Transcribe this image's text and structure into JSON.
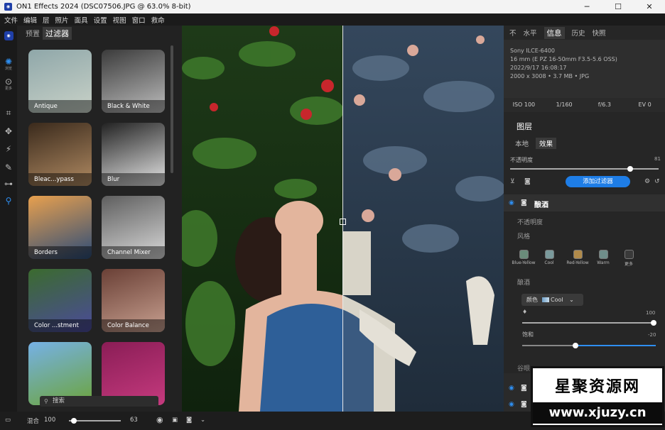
{
  "window": {
    "title": "ON1 Effects 2024 (DSC07506.JPG @ 63.0% 8-bit)"
  },
  "menu": [
    "文件",
    "编辑",
    "层",
    "照片",
    "面具",
    "设置",
    "视图",
    "窗口",
    "救命"
  ],
  "toolbar": {
    "browse_label": "浏览",
    "more_label": "更多"
  },
  "browser": {
    "tabs": [
      "预置",
      "过滤器"
    ],
    "search_placeholder": "搜索",
    "filters": [
      {
        "label": "Antique",
        "colors": [
          "#8fa7a9",
          "#c9d2c8"
        ]
      },
      {
        "label": "Black & White",
        "colors": [
          "#3b3b3b",
          "#bdbdbd"
        ]
      },
      {
        "label": "Bleac...ypass",
        "colors": [
          "#3a2a1c",
          "#b08a62"
        ]
      },
      {
        "label": "Blur",
        "colors": [
          "#222222",
          "#e6e6e6"
        ]
      },
      {
        "label": "Borders",
        "colors": [
          "#e8a04e",
          "#2c4c78"
        ]
      },
      {
        "label": "Channel Mixer",
        "colors": [
          "#5e5e5e",
          "#d8d8d8"
        ]
      },
      {
        "label": "Color ...stment",
        "colors": [
          "#3b6b2e",
          "#4b4a9a"
        ]
      },
      {
        "label": "Color Balance",
        "colors": [
          "#6a4036",
          "#c8a090"
        ]
      },
      {
        "label": "",
        "colors": [
          "#76b1e6",
          "#6ca43c"
        ]
      },
      {
        "label": "",
        "colors": [
          "#8a1d56",
          "#c53a7e"
        ]
      }
    ]
  },
  "info_panel": {
    "tabs": [
      "不",
      "水平",
      "信息",
      "历史",
      "快照"
    ],
    "camera": "Sony ILCE-6400",
    "lens": "16 mm (E PZ 16-50mm F3.5-5.6 OSS)",
    "datetime": "2022/9/17  16:08:17",
    "dimensions": "2000 x 3008 • 3.7 MB • JPG",
    "iso": "ISO 100",
    "shutter": "1/160",
    "aperture": "f/6.3",
    "ev": "EV 0"
  },
  "layers": {
    "title": "图层",
    "tabs": [
      "本地",
      "效果"
    ],
    "opacity_label": "不透明度",
    "opacity_value": "81",
    "opacity_fraction": 0.81,
    "add_filter": "添加过滤器"
  },
  "effect": {
    "name": "酿酒",
    "opacity_label": "不透明度",
    "style_label": "风格",
    "styles": [
      {
        "name": "Blue-Yellow",
        "color": "#6a8c7a"
      },
      {
        "name": "Cool",
        "color": "#7a9a9c"
      },
      {
        "name": "Red-Yellow",
        "color": "#b08a4a"
      },
      {
        "name": "Warm",
        "color": "#6f8e8a"
      },
      {
        "name": "更多",
        "color": "#3a3a3a"
      }
    ],
    "section_label": "酿酒",
    "color_label": "颜色",
    "color_value": "Cool",
    "amount_value": "100",
    "amount_fraction": 1.0,
    "saturation_label": "饱和",
    "saturation_value": "-20",
    "saturation_fraction": 0.4,
    "next_section": "谷眼"
  },
  "statusbar": {
    "mix_label": "混合",
    "mix_value": "100",
    "zoom_value": "63",
    "zoom_fraction": 0.1
  },
  "watermark": {
    "line1": "星聚资源网",
    "line2": "www.xjuzy.cn"
  }
}
